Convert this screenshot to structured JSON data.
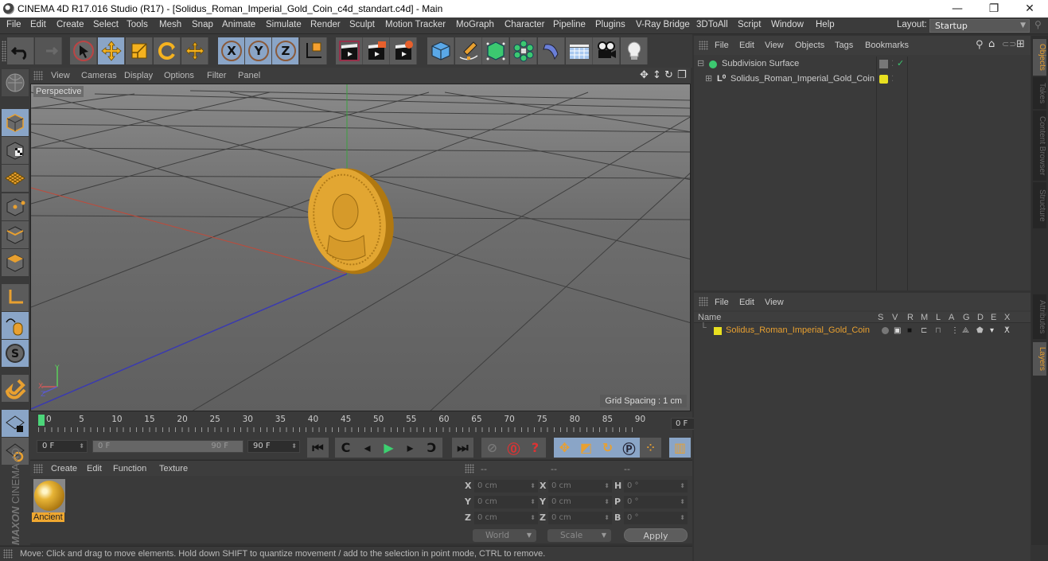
{
  "window": {
    "title": "CINEMA 4D R17.016 Studio (R17) - [Solidus_Roman_Imperial_Gold_Coin_c4d_standart.c4d] - Main",
    "minimize": "—",
    "restore": "❐",
    "close": "✕"
  },
  "menubar": {
    "items": [
      "File",
      "Edit",
      "Create",
      "Select",
      "Tools",
      "Mesh",
      "Snap",
      "Animate",
      "Simulate",
      "Render",
      "Sculpt",
      "Motion Tracker",
      "MoGraph",
      "Character",
      "Pipeline",
      "Plugins",
      "V-Ray Bridge",
      "3DToAll",
      "Script",
      "Window",
      "Help"
    ],
    "layout_label": "Layout:",
    "layout_value": "Startup"
  },
  "toolbar": {
    "icons": [
      "undo-icon",
      "redo-icon",
      "live-selection-icon",
      "move-icon",
      "scale-icon",
      "rotate-icon",
      "recent-tool-icon",
      "x-axis-icon",
      "y-axis-icon",
      "z-axis-icon",
      "coordinate-system-icon",
      "render-view-icon",
      "render-picture-viewer-icon",
      "render-settings-icon",
      "cube-icon",
      "pen-icon",
      "subdivision-icon",
      "array-icon",
      "deformer-icon",
      "floor-icon",
      "camera-icon",
      "light-icon"
    ]
  },
  "left_toolbar": {
    "icons": [
      "model-mode-icon",
      "texture-mode-icon",
      "workplane-icon",
      "points-mode-icon",
      "edges-mode-icon",
      "polygons-mode-icon",
      "axis-icon",
      "tweak-icon",
      "snap-icon",
      "magnet-icon",
      "lock-workplane-icon",
      "workplane-alignment-icon"
    ]
  },
  "viewport": {
    "menu": [
      "View",
      "Cameras",
      "Display",
      "Options",
      "Filter",
      "Panel"
    ],
    "label": "Perspective",
    "grid_spacing": "Grid Spacing : 1 cm",
    "axis_y": "Y",
    "axis_x": "X",
    "axis_z": "Z"
  },
  "timeline": {
    "ticks": [
      "0",
      "5",
      "10",
      "15",
      "20",
      "25",
      "30",
      "35",
      "40",
      "45",
      "50",
      "55",
      "60",
      "65",
      "70",
      "75",
      "80",
      "85",
      "90"
    ],
    "current_frame": "0 F"
  },
  "transport": {
    "start_frame": "0 F",
    "range_start": "0 F",
    "range_end": "90 F",
    "end_frame": "90 F"
  },
  "materials": {
    "menu": [
      "Create",
      "Edit",
      "Function",
      "Texture"
    ],
    "items": [
      {
        "name": "Ancient"
      }
    ]
  },
  "coordinates": {
    "headers": [
      "--",
      "--",
      "--"
    ],
    "rows": [
      {
        "l1": "X",
        "v1": "0 cm",
        "l2": "X",
        "v2": "0 cm",
        "l3": "H",
        "v3": "0 °"
      },
      {
        "l1": "Y",
        "v1": "0 cm",
        "l2": "Y",
        "v2": "0 cm",
        "l3": "P",
        "v3": "0 °"
      },
      {
        "l1": "Z",
        "v1": "0 cm",
        "l2": "Z",
        "v2": "0 cm",
        "l3": "B",
        "v3": "0 °"
      }
    ],
    "space": "World",
    "mode": "Scale",
    "apply": "Apply"
  },
  "status": {
    "text": "Move: Click and drag to move elements. Hold down SHIFT to quantize movement / add to the selection in point mode, CTRL to remove."
  },
  "object_manager": {
    "menu": [
      "File",
      "Edit",
      "View",
      "Objects",
      "Tags",
      "Bookmarks"
    ],
    "objects": [
      {
        "name": "Subdivision Surface",
        "color": "#9fd36a"
      },
      {
        "name": "Solidus_Roman_Imperial_Gold_Coin",
        "color": "#cfcfcf"
      }
    ]
  },
  "layer_manager": {
    "menu": [
      "File",
      "Edit",
      "View"
    ],
    "columns": [
      "Name",
      "S",
      "V",
      "R",
      "M",
      "L",
      "A",
      "G",
      "D",
      "E",
      "X"
    ],
    "layers": [
      {
        "name": "Solidus_Roman_Imperial_Gold_Coin",
        "color": "#e8a030",
        "swatch": "#e8e020"
      }
    ]
  },
  "right_tabs": {
    "top": [
      "Objects",
      "Takes",
      "Content Browser",
      "Structure"
    ],
    "bottom": [
      "Attributes",
      "Layers"
    ]
  },
  "maxon": {
    "brand": "MAXON",
    "product": "CINEMA 4D"
  }
}
